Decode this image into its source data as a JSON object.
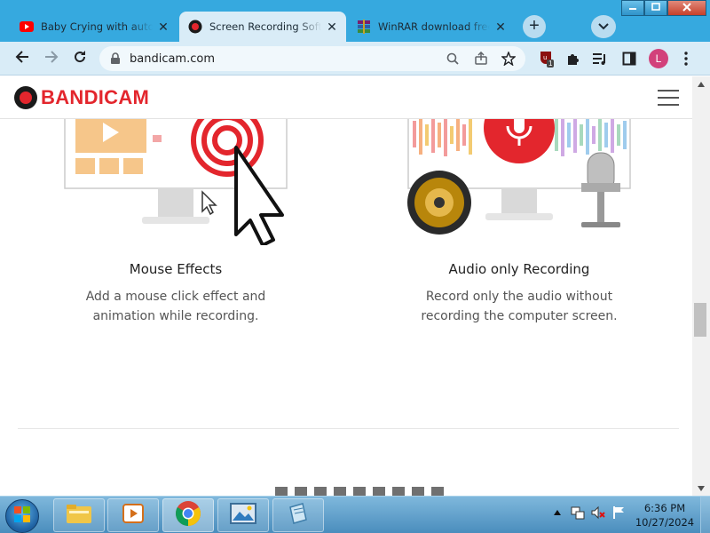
{
  "browser": {
    "tabs": [
      {
        "title": "Baby Crying with auto Tune",
        "icon": "youtube-icon",
        "close": "✕"
      },
      {
        "title": "Screen Recording Software",
        "icon": "bandicam-icon",
        "close": "✕"
      },
      {
        "title": "WinRAR download free",
        "icon": "winrar-icon",
        "close": "✕"
      }
    ],
    "new_tab_label": "+",
    "address": "bandicam.com",
    "profile_initial": "L",
    "extension_badge": "1"
  },
  "site": {
    "logo_text": "BANDICAM",
    "brand_color": "#e3262d"
  },
  "features": [
    {
      "title": "Mouse Effects",
      "desc_line1": "Add a mouse click effect and",
      "desc_line2": "animation while recording."
    },
    {
      "title": "Audio only Recording",
      "desc_line1": "Record only the audio without",
      "desc_line2": "recording the computer screen."
    }
  ],
  "taskbar": {
    "time": "6:36 PM",
    "date": "10/27/2024"
  }
}
